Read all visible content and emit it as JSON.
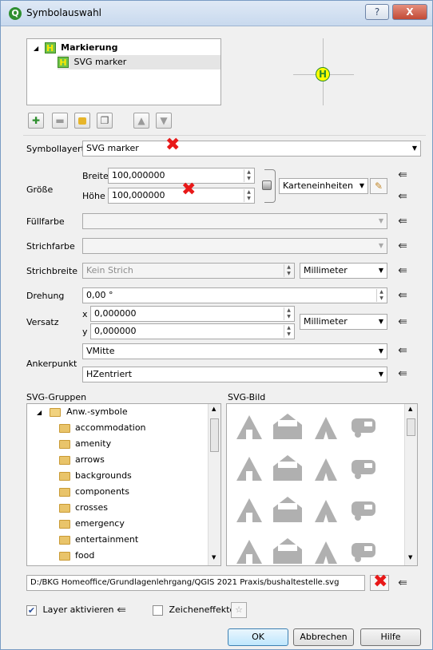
{
  "window": {
    "title": "Symbolauswahl",
    "help_symbol": "?",
    "close_symbol": "X"
  },
  "layer_tree": {
    "root": {
      "label": "Markierung",
      "expander": "◢"
    },
    "child": {
      "label": "SVG marker"
    }
  },
  "preview": {
    "marker_letter": "H"
  },
  "layer_buttons": [
    {
      "icon": "add-layer-icon",
      "glyph": "✚"
    },
    {
      "icon": "remove-layer-icon",
      "glyph": "▬"
    },
    {
      "icon": "lock-layer-icon",
      "glyph": "🔒"
    },
    {
      "icon": "duplicate-layer-icon",
      "glyph": "❐"
    },
    {
      "icon": "move-up-icon",
      "glyph": "▲"
    },
    {
      "icon": "move-down-icon",
      "glyph": "▼"
    }
  ],
  "symbollayertyp": {
    "label": "Symbollayertyp",
    "value": "SVG marker"
  },
  "size": {
    "label": "Größe",
    "width_label": "Breite",
    "width_value": "100,000000",
    "height_label": "Höhe",
    "height_value": "100,000000",
    "unit": "Karteneinheiten"
  },
  "fill": {
    "label": "Füllfarbe"
  },
  "stroke": {
    "label": "Strichfarbe"
  },
  "stroke_width": {
    "label": "Strichbreite",
    "value": "Kein Strich",
    "unit": "Millimeter"
  },
  "rotation": {
    "label": "Drehung",
    "value": "0,00 °"
  },
  "offset": {
    "label": "Versatz",
    "x_label": "x",
    "x_value": "0,000000",
    "y_label": "y",
    "y_value": "0,000000",
    "unit": "Millimeter"
  },
  "anchor": {
    "label": "Ankerpunkt",
    "vertical": "VMitte",
    "horizontal": "HZentriert"
  },
  "svg_groups": {
    "label": "SVG-Gruppen",
    "root": "Anw.-symbole",
    "items": [
      "accommodation",
      "amenity",
      "arrows",
      "backgrounds",
      "components",
      "crosses",
      "emergency",
      "entertainment",
      "food"
    ]
  },
  "svg_image": {
    "label": "SVG-Bild",
    "icons": [
      "hiking-icon",
      "bed-and-breakfast-icon",
      "camping-icon",
      "caravan-icon",
      "hotel-icon",
      "hostel-icon",
      "house-icon",
      "shelter-icon",
      "shelter-rain-icon",
      "chalet-icon",
      "bench-icon",
      "justice-icon",
      "fire-icon",
      "fire-brigade-icon",
      "fire-station-icon",
      "fountain-icon"
    ]
  },
  "path": {
    "value": "D:/BKG Homeoffice/Grundlagenlehrgang/QGIS 2021 Praxis/bushaltestelle.svg"
  },
  "enable_layer": {
    "label": "Layer aktivieren",
    "checked": true
  },
  "draw_effects": {
    "label": "Zeicheneffekte",
    "checked": false
  },
  "buttons": {
    "ok": "OK",
    "cancel": "Abbrechen",
    "help": "Hilfe"
  },
  "marks": {
    "red_x": "✖",
    "data_defined_glyph": "⇚"
  }
}
